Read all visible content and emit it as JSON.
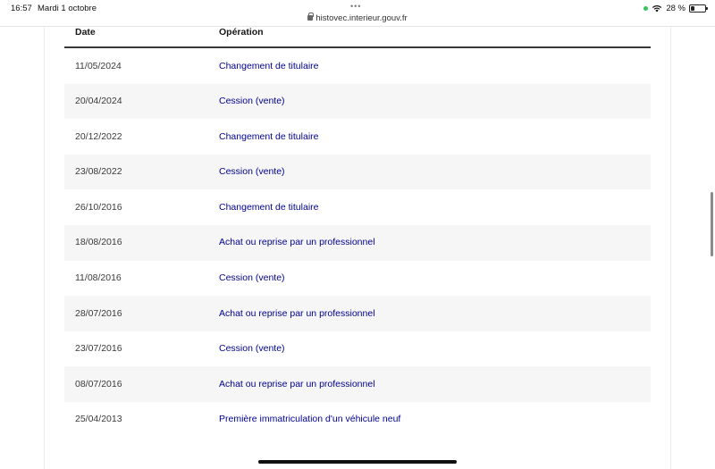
{
  "status_bar": {
    "time": "16:57",
    "date": "Mardi 1 octobre",
    "url": "histovec.interieur.gouv.fr",
    "battery": "28 %",
    "battery_level": 0.28
  },
  "table": {
    "headers": {
      "date": "Date",
      "operation": "Opération"
    },
    "rows": [
      {
        "date": "11/05/2024",
        "operation": "Changement de titulaire"
      },
      {
        "date": "20/04/2024",
        "operation": "Cession (vente)"
      },
      {
        "date": "20/12/2022",
        "operation": "Changement de titulaire"
      },
      {
        "date": "23/08/2022",
        "operation": "Cession (vente)"
      },
      {
        "date": "26/10/2016",
        "operation": "Changement de titulaire"
      },
      {
        "date": "18/08/2016",
        "operation": "Achat ou reprise par un professionnel"
      },
      {
        "date": "11/08/2016",
        "operation": "Cession (vente)"
      },
      {
        "date": "28/07/2016",
        "operation": "Achat ou reprise par un professionnel"
      },
      {
        "date": "23/07/2016",
        "operation": "Cession (vente)"
      },
      {
        "date": "08/07/2016",
        "operation": "Achat ou reprise par un professionnel"
      },
      {
        "date": "25/04/2013",
        "operation": "Première immatriculation d'un véhicule neuf"
      }
    ]
  },
  "colors": {
    "link": "#000091",
    "row_stripe": "#f6f6f6",
    "header_rule": "#3a3a3a"
  }
}
